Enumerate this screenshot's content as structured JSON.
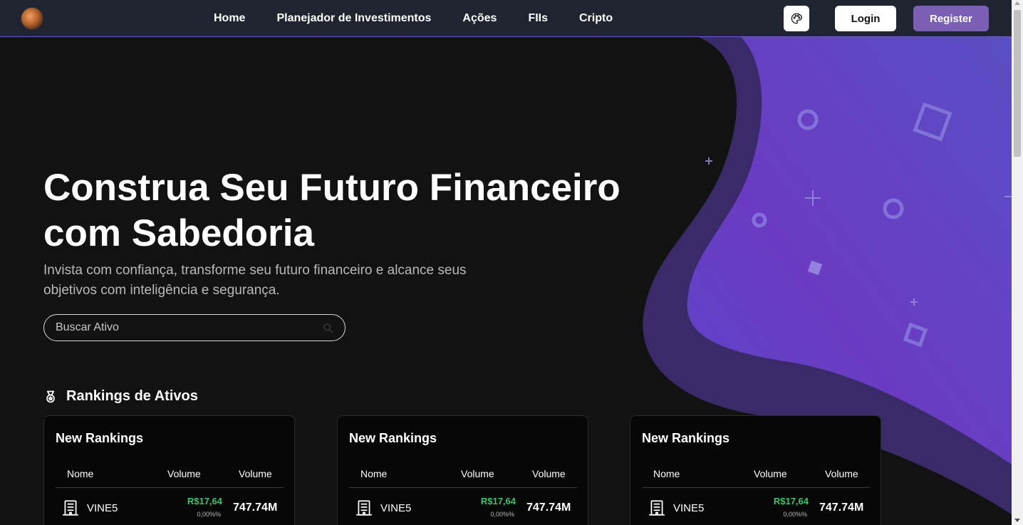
{
  "nav": {
    "links": [
      "Home",
      "Planejador de Investimentos",
      "Ações",
      "FIIs",
      "Cripto"
    ],
    "login_label": "Login",
    "register_label": "Register",
    "theme_icon": "palette-icon"
  },
  "hero": {
    "title_line1": "Construa Seu Futuro Financeiro",
    "title_line2": "com Sabedoria",
    "subtitle": "Invista com confiança, transforme seu futuro financeiro e alcance seus objetivos com inteligência e segurança.",
    "search_placeholder": "Buscar Ativo"
  },
  "rankings": {
    "title": "Rankings de Ativos",
    "cards": [
      {
        "title": "New Rankings",
        "headers": [
          "Nome",
          "Volume",
          "Volume"
        ],
        "row": {
          "name": "VINE5",
          "price": "R$17,64",
          "change": "0,00%%",
          "volume": "747.74M"
        }
      },
      {
        "title": "New Rankings",
        "headers": [
          "Nome",
          "Volume",
          "Volume"
        ],
        "row": {
          "name": "VINE5",
          "price": "R$17,64",
          "change": "0,00%%",
          "volume": "747.74M"
        }
      },
      {
        "title": "New Rankings",
        "headers": [
          "Nome",
          "Volume",
          "Volume"
        ],
        "row": {
          "name": "VINE5",
          "price": "R$17,64",
          "change": "0,00%%",
          "volume": "747.74M"
        }
      }
    ]
  },
  "colors": {
    "accent": "#7a5fb5",
    "positive": "#3ec46d",
    "navbar": "#1f2430",
    "background": "#121212"
  }
}
